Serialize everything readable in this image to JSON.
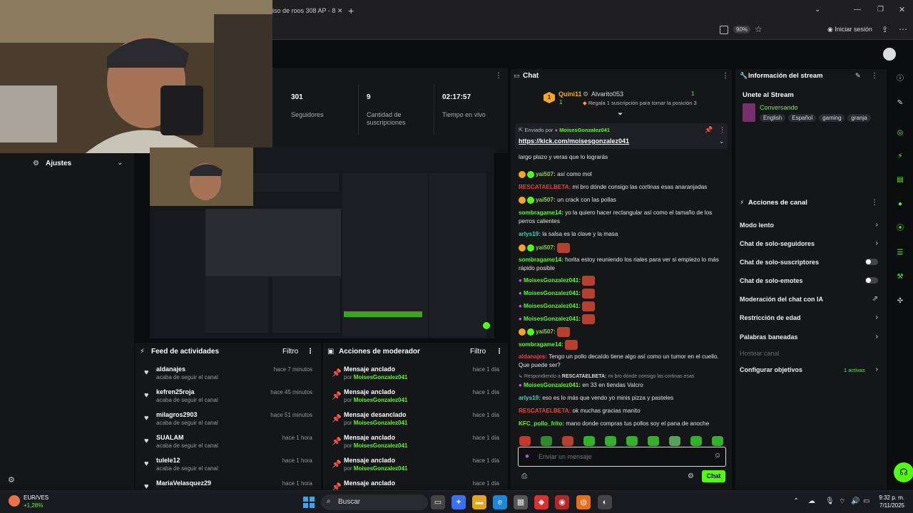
{
  "browser": {
    "tab_title": "iso de roos 308 AP - 8",
    "zoom": "90%",
    "signin": "Iniciar sesión"
  },
  "sidebar": {
    "settings_label": "Ajustes"
  },
  "stats": [
    {
      "value": "301",
      "label": "Seguidores"
    },
    {
      "value": "9",
      "label": "Cantidad de suscripciones"
    },
    {
      "value": "02:17:57",
      "label": "Tiempo en vivo"
    }
  ],
  "activity_feed": {
    "title": "Feed de actividades",
    "filter": "Filtro",
    "items": [
      {
        "user": "aldanajes",
        "action": "acaba de seguir el canal",
        "time": "hace 7 minutos"
      },
      {
        "user": "kefren25roja",
        "action": "acaba de seguir el canal",
        "time": "hace 45 minutos"
      },
      {
        "user": "milagros2903",
        "action": "acaba de seguir el canal",
        "time": "hace 51 minutos"
      },
      {
        "user": "SUALAM",
        "action": "acaba de seguir el canal",
        "time": "hace 1 hora"
      },
      {
        "user": "tulele12",
        "action": "acaba de seguir el canal",
        "time": "hace 1 hora"
      },
      {
        "user": "MariaVelasquez29",
        "action": "",
        "time": "hace 1 hora"
      }
    ]
  },
  "mod_actions": {
    "title": "Acciones de moderador",
    "filter": "Filtro",
    "items": [
      {
        "action": "Mensaje anclado",
        "by": "por",
        "mod": "MoisesGonzalez041",
        "time": "hace 1 día"
      },
      {
        "action": "Mensaje anclado",
        "by": "por",
        "mod": "MoisesGonzalez041",
        "time": "hace 1 día"
      },
      {
        "action": "Mensaje desanclado",
        "by": "por",
        "mod": "MoisesGonzalez041",
        "time": "hace 1 día"
      },
      {
        "action": "Mensaje anclado",
        "by": "por",
        "mod": "MoisesGonzalez041",
        "time": "hace 1 día"
      },
      {
        "action": "Mensaje anclado",
        "by": "por",
        "mod": "MoisesGonzalez041",
        "time": "hace 1 día"
      },
      {
        "action": "Mensaje anclado",
        "by": "",
        "mod": "",
        "time": "hace 1 día"
      }
    ]
  },
  "chat": {
    "title": "Chat",
    "top_gifter": "Quini11",
    "top_gifter_count": "1",
    "second_gifter": "Alvarito053",
    "second_count": "1",
    "gift_note": "Regala 1 suscripción para tomar la posición 3",
    "pinned_sender_label": "Enviado por",
    "pinned_sender": "MoisesGonzalez041",
    "pinned_link": "https://kick.com/moisesgonzalez041",
    "messages": [
      {
        "user": "",
        "color": "#e84040",
        "text": "largo plazo y veras que lo lograrás"
      },
      {
        "user": "yai507:",
        "color": "#8fd14f",
        "text": "así como mol"
      },
      {
        "user": "RESCATAELBETA:",
        "color": "#e84040",
        "text": "mi bro dónde consigo las cortinas esas anaranjadas"
      },
      {
        "user": "yai507:",
        "color": "#8fd14f",
        "text": "un crack con las pollas"
      },
      {
        "user": "sombragame14:",
        "color": "#53fc18",
        "text": "yo la quiero hacer rectangular así como el tamaño de los perros calientes"
      },
      {
        "user": "arlys19:",
        "color": "#3fd1b9",
        "text": "la salsa es la clave y la masa"
      },
      {
        "user": "yai507:",
        "color": "#8fd14f",
        "text": ""
      },
      {
        "user": "sombragame14:",
        "color": "#53fc18",
        "text": "horita estoy reuniendo los riales para ver si empiezo lo más rápido posible"
      },
      {
        "user": "MoisesGonzalez041:",
        "color": "#53fc18",
        "text": ""
      },
      {
        "user": "MoisesGonzalez041:",
        "color": "#53fc18",
        "text": ""
      },
      {
        "user": "MoisesGonzalez041:",
        "color": "#53fc18",
        "text": ""
      },
      {
        "user": "MoisesGonzalez041:",
        "color": "#53fc18",
        "text": ""
      },
      {
        "user": "yai507:",
        "color": "#8fd14f",
        "text": ""
      },
      {
        "user": "sombragame14:",
        "color": "#53fc18",
        "text": ""
      },
      {
        "user": "aldanajes:",
        "color": "#e84040",
        "text": "Tengo un pollo decaído tiene algo así como un tumor en el cuello. Que puede ser?"
      },
      {
        "user": "MoisesGonzalez041:",
        "color": "#53fc18",
        "text": "en 33 en tiendas Valcro"
      },
      {
        "user": "arlys19:",
        "color": "#3fd1b9",
        "text": "eso es lo más que vendo yo minis pizza y pasteles"
      },
      {
        "user": "RESCATAELBETA:",
        "color": "#e84040",
        "text": "ok muchas gracias manito"
      },
      {
        "user": "KFC_pollo_frito:",
        "color": "#53fc18",
        "text": "mano donde compras tus pollos soy el pana de anoche"
      }
    ],
    "reply_to_label": "Respondiendo a",
    "reply_to_user": "RESCATAELBETA:",
    "reply_to_text": "mi bro dónde consigo las cortinas esas",
    "input_placeholder": "Enviar un mensaje",
    "send_label": "Chat"
  },
  "stream_info": {
    "title": "Información del stream",
    "stream_title": "Unete al Stream",
    "category": "Conversando",
    "tags": [
      "English",
      "Español",
      "gaming",
      "granja"
    ]
  },
  "channel_actions": {
    "title": "Acciones de canal",
    "items": [
      {
        "label": "Modo lento",
        "kind": "chevron"
      },
      {
        "label": "Chat de solo-seguidores",
        "kind": "chevron"
      },
      {
        "label": "Chat de solo-suscriptores",
        "kind": "toggle"
      },
      {
        "label": "Chat de solo-emotes",
        "kind": "toggle"
      },
      {
        "label": "Moderación del chat con IA",
        "kind": "external"
      },
      {
        "label": "Restricción de edad",
        "kind": "chevron"
      },
      {
        "label": "Palabras baneadas",
        "kind": "chevron"
      },
      {
        "label": "Hostear canal",
        "kind": "disabled"
      },
      {
        "label": "Configurar objetivos",
        "kind": "chevron"
      }
    ],
    "goals_active": "1 activas"
  },
  "taskbar": {
    "weather_label": "EUR/VES",
    "weather_value": "+1,28%",
    "search": "Buscar",
    "time": "9:32 p. m.",
    "date": "7/11/2025"
  },
  "colors": {
    "accent": "#53fc18",
    "panel": "#151618",
    "bg": "#0b0c0e"
  }
}
